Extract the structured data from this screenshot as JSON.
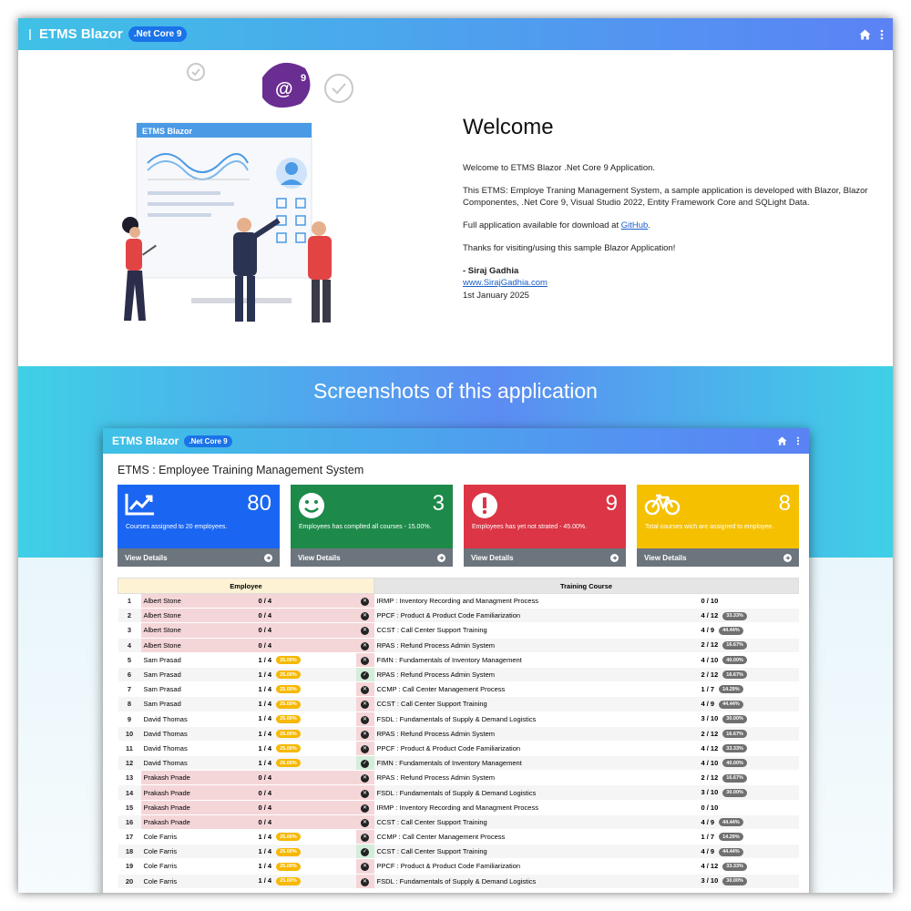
{
  "navbar": {
    "brand": "ETMS Blazor",
    "badge": ".Net Core 9",
    "icons": [
      "home-icon",
      "kebab-menu-icon"
    ]
  },
  "illustration": {
    "panel_label": "ETMS Blazor",
    "logo_badge": "9"
  },
  "welcome": {
    "heading": "Welcome",
    "p1": "Welcome to ETMS Blazor .Net Core 9 Application.",
    "p2": "This ETMS: Employe Traning Management System, a sample application is developed with Blazor, Blazor Componentes, .Net Core 9, Visual Studio 2022, Entity Framework Core and SQLight Data.",
    "p3_prefix": "Full application available for download at ",
    "p3_link": "GitHub",
    "p3_suffix": ".",
    "p4": "Thanks for visiting/using this sample Blazor Application!",
    "author": "- Siraj Gadhia",
    "website": "www.SirajGadhia.com",
    "date": "1st January 2025"
  },
  "screenshots_title": "Screenshots of this application",
  "screenshot": {
    "brand": "ETMS Blazor",
    "badge": ".Net Core 9",
    "title": "ETMS : Employee Training Management System",
    "view_details": "View Details",
    "cards": [
      {
        "value": "80",
        "desc": "Courses assigned to 20 employees.",
        "color": "#1a66f2",
        "icon": "chart-line-icon"
      },
      {
        "value": "3",
        "desc": "Employees has complted all courses - 15.00%.",
        "color": "#1d8a4a",
        "icon": "smiley-icon"
      },
      {
        "value": "9",
        "desc": "Employees has yet not strated - 45.00%.",
        "color": "#dc3545",
        "icon": "exclamation-icon"
      },
      {
        "value": "8",
        "desc": "Total courses wich are assigned to employee.",
        "color": "#f5c000",
        "icon": "bicycle-icon"
      }
    ],
    "headers": {
      "employee": "Employee",
      "course": "Training Course"
    },
    "rows": [
      {
        "n": "1",
        "emp": "Albert Stone",
        "prog": "0 / 4",
        "emp_pct": "",
        "done": false,
        "course": "IRMP : Inventory Recording and Managment Process",
        "cprog": "0 / 10",
        "cpct": ""
      },
      {
        "n": "2",
        "emp": "Albert Stone",
        "prog": "0 / 4",
        "emp_pct": "",
        "done": false,
        "course": "PPCF : Product & Product Code Familiarization",
        "cprog": "4 / 12",
        "cpct": "33.33%"
      },
      {
        "n": "3",
        "emp": "Albert Stone",
        "prog": "0 / 4",
        "emp_pct": "",
        "done": false,
        "course": "CCST : Call Center Support Training",
        "cprog": "4 / 9",
        "cpct": "44.44%"
      },
      {
        "n": "4",
        "emp": "Albert Stone",
        "prog": "0 / 4",
        "emp_pct": "",
        "done": false,
        "course": "RPAS : Refund Process Admin System",
        "cprog": "2 / 12",
        "cpct": "16.67%"
      },
      {
        "n": "5",
        "emp": "Sam Prasad",
        "prog": "1 / 4",
        "emp_pct": "25.00%",
        "done": false,
        "course": "FIMN : Fundamentals of Inventory Management",
        "cprog": "4 / 10",
        "cpct": "40.00%"
      },
      {
        "n": "6",
        "emp": "Sam Prasad",
        "prog": "1 / 4",
        "emp_pct": "25.00%",
        "done": true,
        "course": "RPAS : Refund Process Admin System",
        "cprog": "2 / 12",
        "cpct": "16.67%"
      },
      {
        "n": "7",
        "emp": "Sam Prasad",
        "prog": "1 / 4",
        "emp_pct": "25.00%",
        "done": false,
        "course": "CCMP : Call Center Management Process",
        "cprog": "1 / 7",
        "cpct": "14.29%"
      },
      {
        "n": "8",
        "emp": "Sam Prasad",
        "prog": "1 / 4",
        "emp_pct": "25.00%",
        "done": false,
        "course": "CCST : Call Center Support Training",
        "cprog": "4 / 9",
        "cpct": "44.44%"
      },
      {
        "n": "9",
        "emp": "David Thomas",
        "prog": "1 / 4",
        "emp_pct": "25.00%",
        "done": false,
        "course": "FSDL : Fundamentals of Supply & Demand Logistics",
        "cprog": "3 / 10",
        "cpct": "30.00%"
      },
      {
        "n": "10",
        "emp": "David Thomas",
        "prog": "1 / 4",
        "emp_pct": "25.00%",
        "done": false,
        "course": "RPAS : Refund Process Admin System",
        "cprog": "2 / 12",
        "cpct": "16.67%"
      },
      {
        "n": "11",
        "emp": "David Thomas",
        "prog": "1 / 4",
        "emp_pct": "25.00%",
        "done": false,
        "course": "PPCF : Product & Product Code Familiarization",
        "cprog": "4 / 12",
        "cpct": "33.33%"
      },
      {
        "n": "12",
        "emp": "David Thomas",
        "prog": "1 / 4",
        "emp_pct": "25.00%",
        "done": true,
        "course": "FIMN : Fundamentals of Inventory Management",
        "cprog": "4 / 10",
        "cpct": "40.00%"
      },
      {
        "n": "13",
        "emp": "Prakash Pnade",
        "prog": "0 / 4",
        "emp_pct": "",
        "done": false,
        "course": "RPAS : Refund Process Admin System",
        "cprog": "2 / 12",
        "cpct": "16.67%"
      },
      {
        "n": "14",
        "emp": "Prakash Pnade",
        "prog": "0 / 4",
        "emp_pct": "",
        "done": false,
        "course": "FSDL : Fundamentals of Supply & Demand Logistics",
        "cprog": "3 / 10",
        "cpct": "30.00%"
      },
      {
        "n": "15",
        "emp": "Prakash Pnade",
        "prog": "0 / 4",
        "emp_pct": "",
        "done": false,
        "course": "IRMP : Inventory Recording and Managment Process",
        "cprog": "0 / 10",
        "cpct": ""
      },
      {
        "n": "16",
        "emp": "Prakash Pnade",
        "prog": "0 / 4",
        "emp_pct": "",
        "done": false,
        "course": "CCST : Call Center Support Training",
        "cprog": "4 / 9",
        "cpct": "44.44%"
      },
      {
        "n": "17",
        "emp": "Cole Farris",
        "prog": "1 / 4",
        "emp_pct": "25.00%",
        "done": false,
        "course": "CCMP : Call Center Management Process",
        "cprog": "1 / 7",
        "cpct": "14.29%"
      },
      {
        "n": "18",
        "emp": "Cole Farris",
        "prog": "1 / 4",
        "emp_pct": "25.00%",
        "done": true,
        "course": "CCST : Call Center Support Training",
        "cprog": "4 / 9",
        "cpct": "44.44%"
      },
      {
        "n": "19",
        "emp": "Cole Farris",
        "prog": "1 / 4",
        "emp_pct": "25.00%",
        "done": false,
        "course": "PPCF : Product & Product Code Familiarization",
        "cprog": "4 / 12",
        "cpct": "33.33%"
      },
      {
        "n": "20",
        "emp": "Cole Farris",
        "prog": "1 / 4",
        "emp_pct": "25.00%",
        "done": false,
        "course": "FSDL : Fundamentals of Supply & Demand Logistics",
        "cprog": "3 / 10",
        "cpct": "30.00%"
      }
    ]
  }
}
